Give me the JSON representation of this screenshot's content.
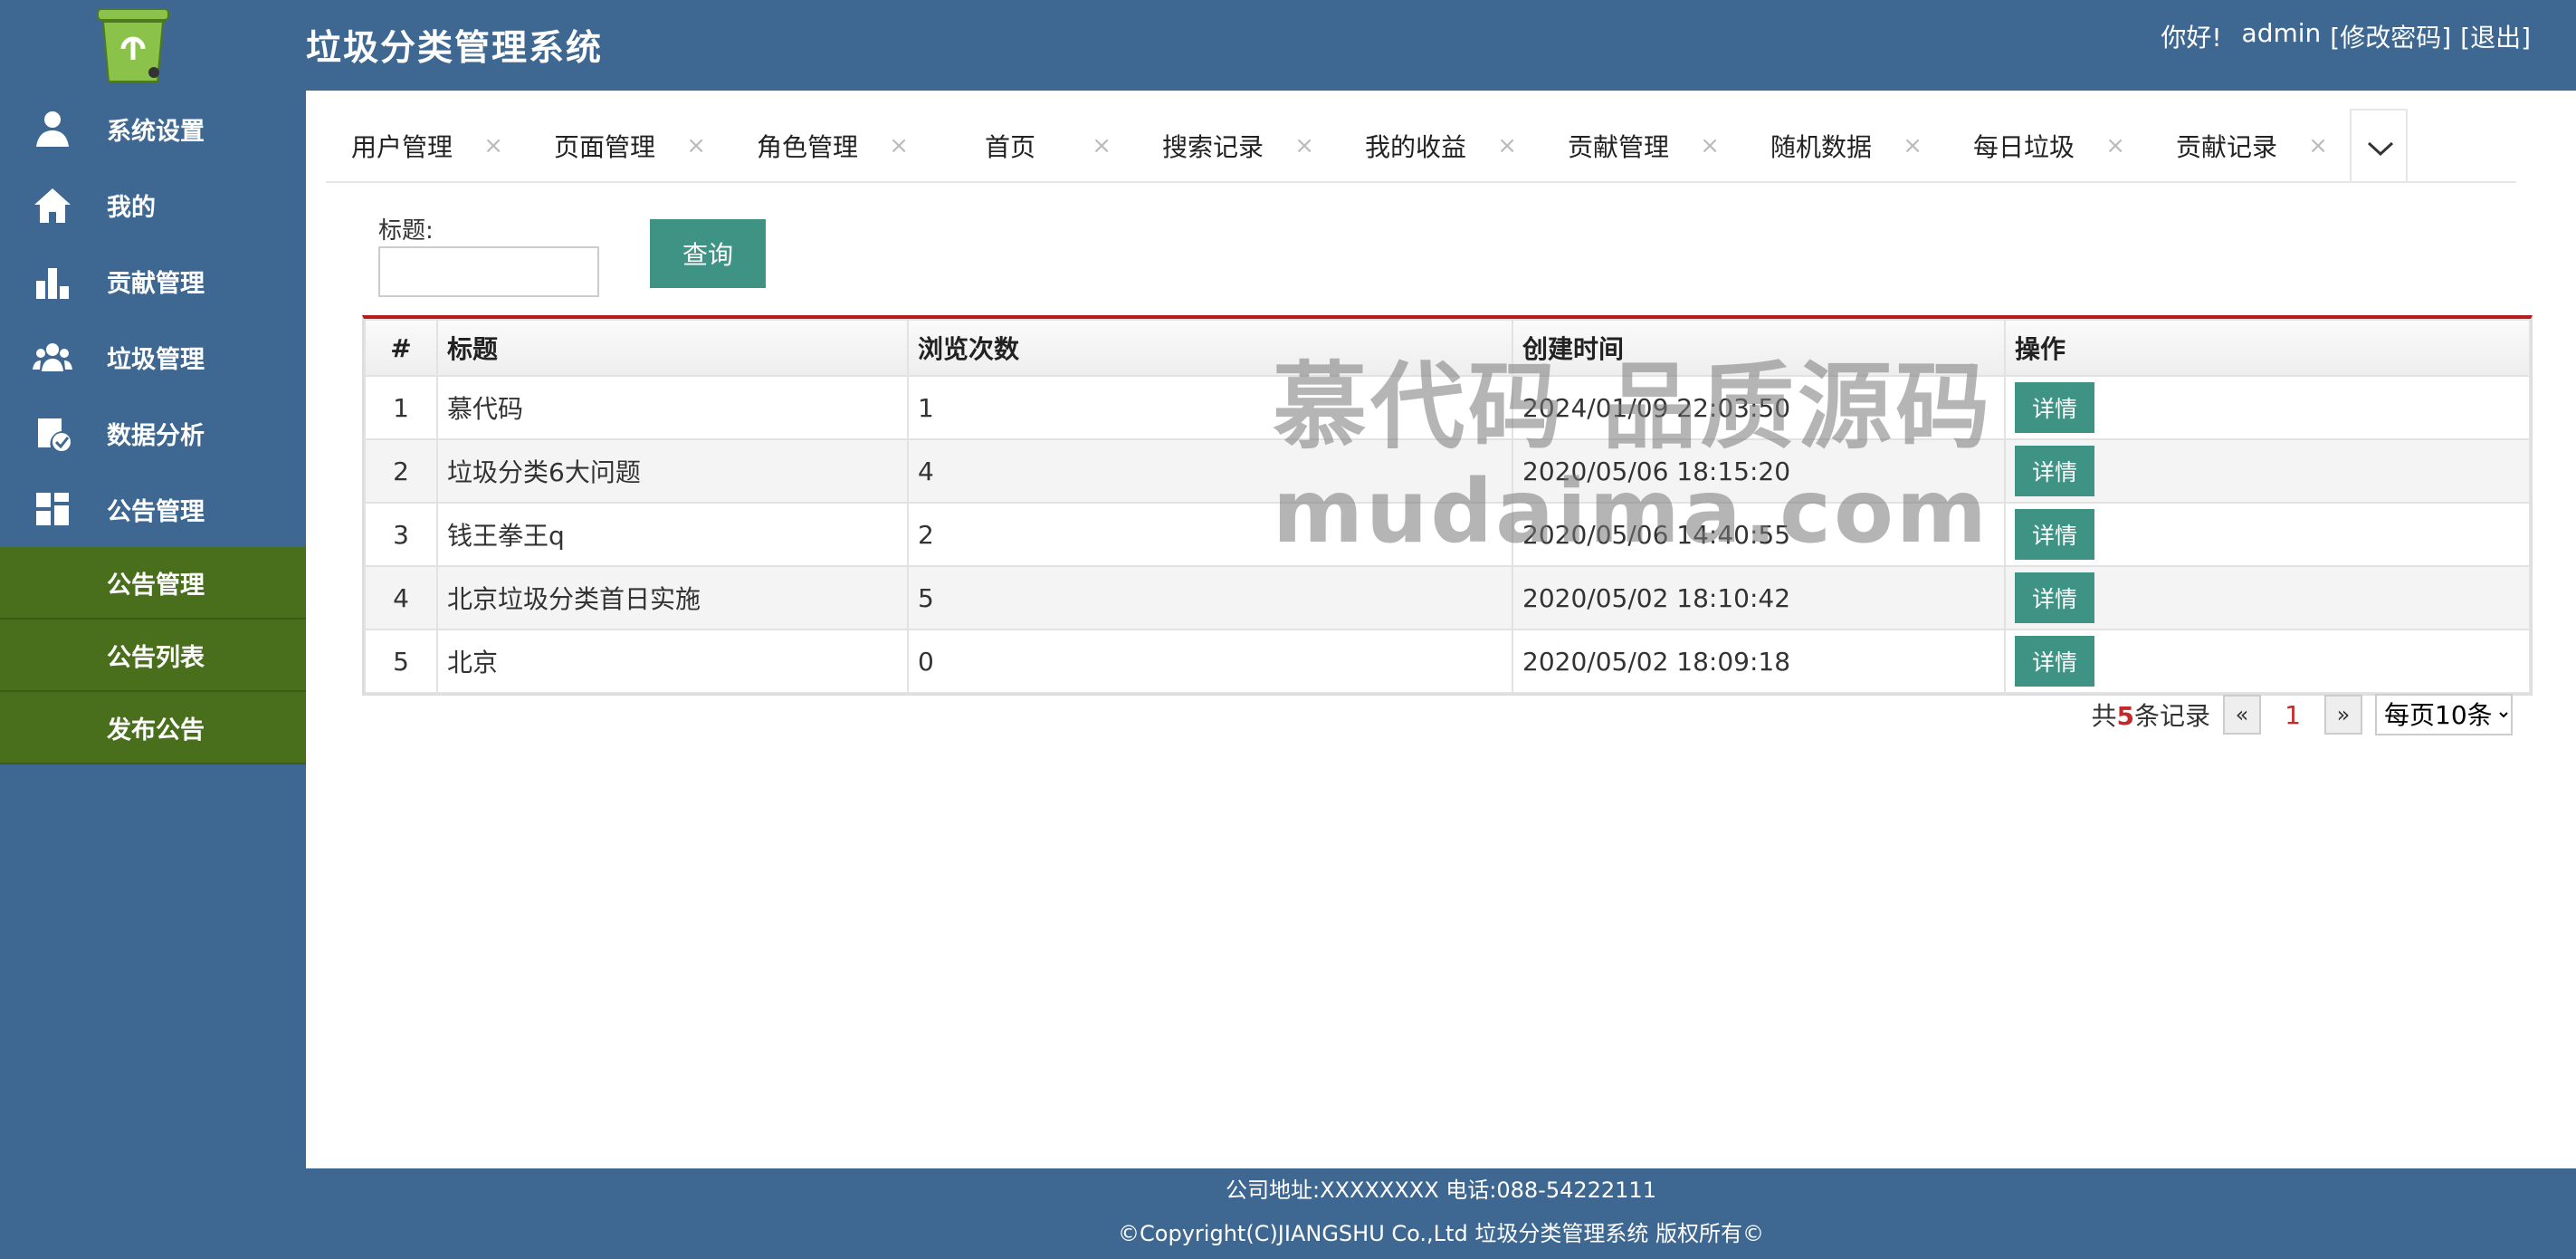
{
  "app": {
    "title": "垃圾分类管理系统"
  },
  "user": {
    "greeting": "你好!",
    "name": "admin",
    "change_password": "[修改密码]",
    "logout": "[退出]"
  },
  "sidebar": {
    "items": [
      {
        "label": "系统设置",
        "icon": "user-settings-icon"
      },
      {
        "label": "我的",
        "icon": "home-icon"
      },
      {
        "label": "贡献管理",
        "icon": "bar-chart-icon"
      },
      {
        "label": "垃圾管理",
        "icon": "group-icon"
      },
      {
        "label": "数据分析",
        "icon": "check-badge-icon"
      },
      {
        "label": "公告管理",
        "icon": "grid-icon"
      }
    ],
    "sub_items": [
      {
        "label": "公告管理"
      },
      {
        "label": "公告列表"
      },
      {
        "label": "发布公告"
      }
    ]
  },
  "tabs": [
    {
      "label": "用户管理",
      "close": "×"
    },
    {
      "label": "页面管理",
      "close": "×"
    },
    {
      "label": "角色管理",
      "close": "×"
    },
    {
      "label": "首页",
      "close": "×"
    },
    {
      "label": "搜索记录",
      "close": "×"
    },
    {
      "label": "我的收益",
      "close": "×"
    },
    {
      "label": "贡献管理",
      "close": "×"
    },
    {
      "label": "随机数据",
      "close": "×"
    },
    {
      "label": "每日垃圾",
      "close": "×"
    },
    {
      "label": "贡献记录",
      "close": "×"
    }
  ],
  "filter": {
    "label": "标题:",
    "value": "",
    "placeholder": "",
    "query_button": "查询"
  },
  "table": {
    "headers": [
      "#",
      "标题",
      "浏览次数",
      "创建时间",
      "操作"
    ],
    "rows": [
      {
        "index": "1",
        "title": "慕代码",
        "views": "1",
        "created": "2024/01/09 22:03:50",
        "action": "详情"
      },
      {
        "index": "2",
        "title": "垃圾分类6大问题",
        "views": "4",
        "created": "2020/05/06 18:15:20",
        "action": "详情"
      },
      {
        "index": "3",
        "title": "钱王拳王q",
        "views": "2",
        "created": "2020/05/06 14:40:55",
        "action": "详情"
      },
      {
        "index": "4",
        "title": "北京垃圾分类首日实施",
        "views": "5",
        "created": "2020/05/02 18:10:42",
        "action": "详情"
      },
      {
        "index": "5",
        "title": "北京",
        "views": "0",
        "created": "2020/05/02 18:09:18",
        "action": "详情"
      }
    ]
  },
  "pagination": {
    "total_prefix": "共",
    "total": "5",
    "total_suffix": "条记录",
    "prev": "«",
    "current": "1",
    "next": "»",
    "page_size": "每页10条"
  },
  "watermark": {
    "line1": "慕代码 品质源码",
    "line2": "mudaima.com"
  },
  "footer": {
    "line1": "公司地址:XXXXXXXX 电话:088-54222111",
    "line2": "©Copyright(C)JIANGSHU Co.,Ltd 垃圾分类管理系统 版权所有©"
  },
  "colors": {
    "header": "#3e6891",
    "submenu": "#4a6f1c",
    "button": "#3f9385",
    "accent_line": "#b71c1c"
  }
}
